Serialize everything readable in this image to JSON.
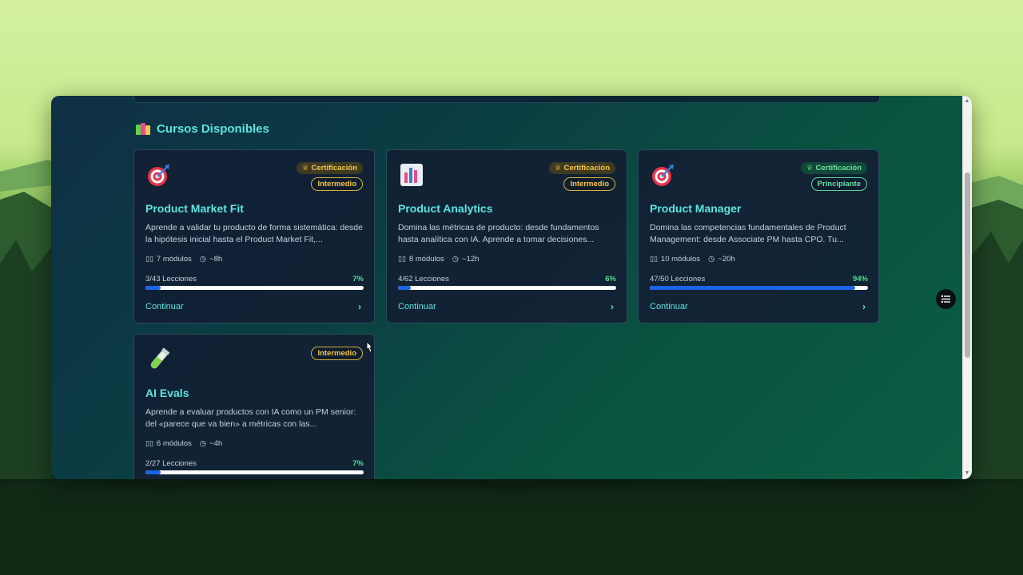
{
  "section": {
    "title": "Cursos Disponibles",
    "icon": "books-icon"
  },
  "courses": [
    {
      "icon": "target-icon",
      "badge_cert": "Certificación",
      "badge_level": "Intermedio",
      "title": "Product Market Fit",
      "description": "Aprende a validar tu producto de forma sistemática: desde la hipótesis inicial hasta el Product Market Fit,...",
      "modules": "7 módulos",
      "duration": "~8h",
      "lessons": "3/43 Lecciones",
      "percent_label": "7%",
      "progress": 0.07,
      "cta": "Continuar"
    },
    {
      "icon": "bar-chart-icon",
      "badge_cert": "Certificación",
      "badge_level": "Intermedio",
      "title": "Product Analytics",
      "description": "Domina las métricas de producto: desde fundamentos hasta analítica con IA. Aprende a tomar decisiones...",
      "modules": "8 módulos",
      "duration": "~12h",
      "lessons": "4/62 Lecciones",
      "percent_label": "6%",
      "progress": 0.06,
      "cta": "Continuar"
    },
    {
      "icon": "target-icon",
      "badge_cert": "Certificación",
      "badge_level": "Principiante",
      "title": "Product Manager",
      "description": "Domina las competencias fundamentales de Product Management: desde Associate PM hasta CPO. Tu...",
      "modules": "10 módulos",
      "duration": "~20h",
      "lessons": "47/50 Lecciones",
      "percent_label": "94%",
      "progress": 0.94,
      "cta": "Continuar"
    },
    {
      "icon": "test-tube-icon",
      "badge_level": "Intermedio",
      "title": "AI Evals",
      "description": "Aprende a evaluar productos con IA como un PM senior: del «parece que va bien» a métricas con las...",
      "modules": "6 módulos",
      "duration": "~4h",
      "lessons": "2/27 Lecciones",
      "percent_label": "7%",
      "progress": 0.07
    }
  ],
  "colors": {
    "accent": "#5ce5e0",
    "progress_fill": "#1c63e8",
    "percent": "#4ee08e",
    "cert_gold": "#f5c842",
    "cert_green": "#6ee0a0"
  },
  "floating_button": {
    "icon": "filter-settings-icon"
  }
}
